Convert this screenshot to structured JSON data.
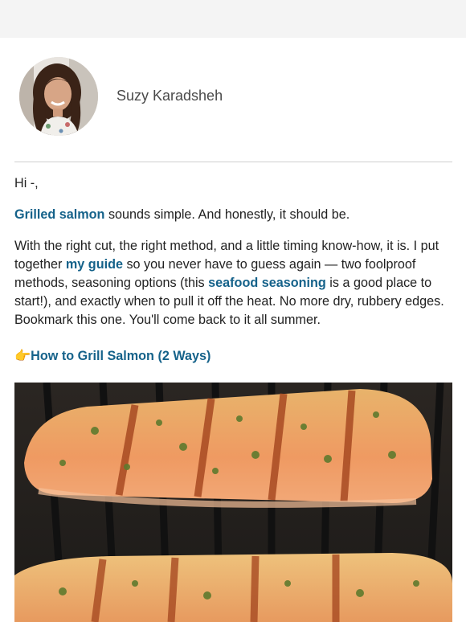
{
  "author": {
    "name": "Suzy Karadsheh"
  },
  "email": {
    "greeting": "Hi -,",
    "para1": {
      "link_text": "Grilled salmon",
      "rest": " sounds simple. And honestly, it should be."
    },
    "para2": {
      "part1": "With the right cut, the right method, and a little timing know-how, it is. I put together ",
      "link1": "my guide",
      "part2": " so you never have to guess again — two foolproof methods, seasoning options (this ",
      "link2": "seafood seasoning",
      "part3": " is a good place to start!), and exactly when to pull it off the heat. No more dry, rubbery edges. Bookmark this one. You'll come back to it all summer."
    },
    "cta": {
      "emoji": "👉",
      "label": "How to Grill Salmon (2 Ways)"
    }
  },
  "colors": {
    "link": "#15628a",
    "text": "#222222",
    "divider": "#cfcfcf"
  }
}
